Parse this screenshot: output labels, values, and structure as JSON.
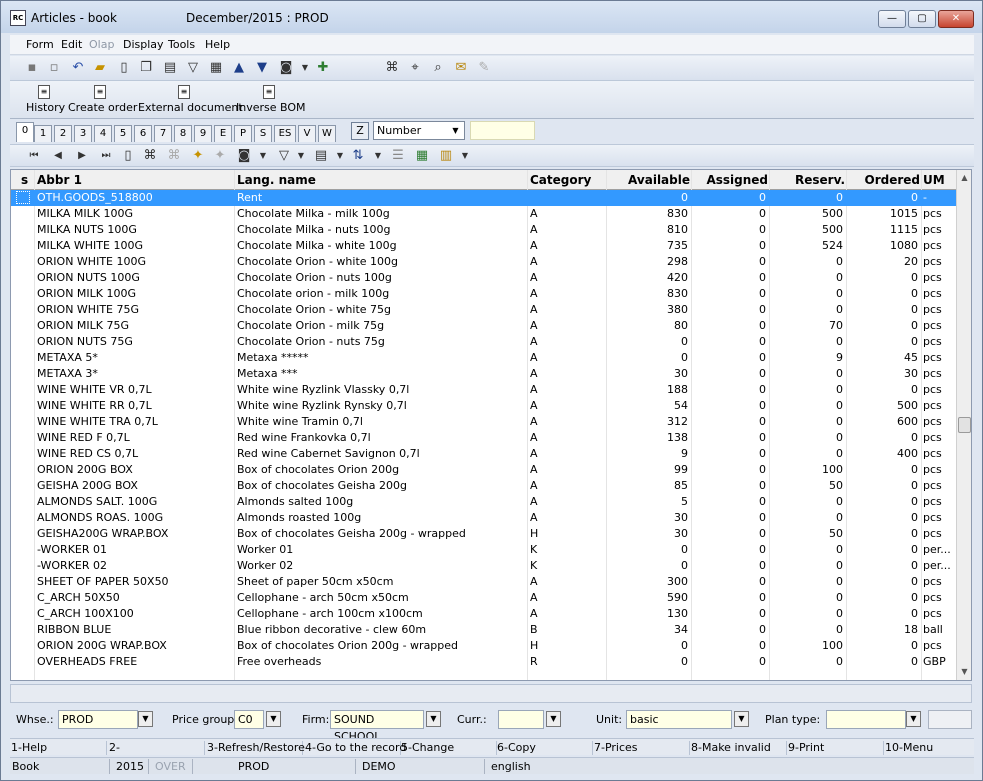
{
  "window": {
    "app_icon_text": "RC",
    "title": "Articles - book",
    "period": "December/2015 : PROD",
    "min_label": "—",
    "max_label": "▢",
    "close_label": "✕"
  },
  "menu": {
    "items": [
      "Form",
      "Edit",
      "Olap",
      "Display",
      "Tools",
      "Help"
    ],
    "disabled": [
      "Olap"
    ]
  },
  "toolbar": {
    "icons": [
      "save-icon",
      "save-as-icon",
      "undo-icon",
      "open-folder-icon",
      "new-document-icon",
      "copy-document-icon",
      "book-icon",
      "filter-icon",
      "filter-document-icon",
      "arrow-up-icon",
      "arrow-down-icon",
      "camera-icon",
      "dropdown-icon",
      "export-icon",
      "binoculars-icon",
      "find-next-icon",
      "find-prev-icon",
      "mail-icon",
      "edit-disabled-icon"
    ]
  },
  "ribbon": {
    "items": [
      {
        "label": "History"
      },
      {
        "label": "Create order"
      },
      {
        "label": "External document"
      },
      {
        "label": "Inverse BOM"
      }
    ]
  },
  "tabs": {
    "items": [
      "0",
      "1",
      "2",
      "3",
      "4",
      "5",
      "6",
      "7",
      "8",
      "9",
      "E",
      "P",
      "S",
      "ES",
      "V",
      "W"
    ],
    "active": "0"
  },
  "sort": {
    "z_label": "Z",
    "value": "Number",
    "dd": "▼"
  },
  "grid": {
    "columns": [
      "s",
      "Abbr 1",
      "Lang. name",
      "Category",
      "Available",
      "Assigned",
      "Reserv.",
      "Ordered",
      "UM"
    ],
    "rows": [
      [
        "",
        "OTH.GOODS_518800",
        "Rent",
        "",
        "0",
        "0",
        "0",
        "0",
        "-"
      ],
      [
        "",
        "MILKA MILK 100G",
        "Chocolate Milka - milk 100g",
        "A",
        "830",
        "0",
        "500",
        "1015",
        "pcs"
      ],
      [
        "",
        "MILKA NUTS 100G",
        "Chocolate Milka - nuts 100g",
        "A",
        "810",
        "0",
        "500",
        "1115",
        "pcs"
      ],
      [
        "",
        "MILKA WHITE 100G",
        "Chocolate Milka - white 100g",
        "A",
        "735",
        "0",
        "524",
        "1080",
        "pcs"
      ],
      [
        "",
        "ORION WHITE 100G",
        "Chocolate Orion - white 100g",
        "A",
        "298",
        "0",
        "0",
        "20",
        "pcs"
      ],
      [
        "",
        "ORION NUTS 100G",
        "Chocolate Orion - nuts 100g",
        "A",
        "420",
        "0",
        "0",
        "0",
        "pcs"
      ],
      [
        "",
        "ORION MILK 100G",
        "Chocolate orion - milk 100g",
        "A",
        "830",
        "0",
        "0",
        "0",
        "pcs"
      ],
      [
        "",
        "ORION WHITE 75G",
        "Chocolate Orion - white 75g",
        "A",
        "380",
        "0",
        "0",
        "0",
        "pcs"
      ],
      [
        "",
        "ORION MILK 75G",
        "Chocolate Orion - milk 75g",
        "A",
        "80",
        "0",
        "70",
        "0",
        "pcs"
      ],
      [
        "",
        "ORION NUTS 75G",
        "Chocolate Orion - nuts 75g",
        "A",
        "0",
        "0",
        "0",
        "0",
        "pcs"
      ],
      [
        "",
        "METAXA 5*",
        "Metaxa *****",
        "A",
        "0",
        "0",
        "9",
        "45",
        "pcs"
      ],
      [
        "",
        "METAXA 3*",
        "Metaxa ***",
        "A",
        "30",
        "0",
        "0",
        "30",
        "pcs"
      ],
      [
        "",
        "WINE WHITE VR 0,7L",
        "White wine Ryzlink Vlassky 0,7l",
        "A",
        "188",
        "0",
        "0",
        "0",
        "pcs"
      ],
      [
        "",
        "WINE WHITE RR 0,7L",
        "White wine Ryzlink Rynsky 0,7l",
        "A",
        "54",
        "0",
        "0",
        "500",
        "pcs"
      ],
      [
        "",
        "WINE WHITE TRA 0,7L",
        "White wine Tramin 0,7l",
        "A",
        "312",
        "0",
        "0",
        "600",
        "pcs"
      ],
      [
        "",
        "WINE RED F 0,7L",
        "Red wine Frankovka 0,7l",
        "A",
        "138",
        "0",
        "0",
        "0",
        "pcs"
      ],
      [
        "",
        "WINE RED CS 0,7L",
        "Red wine Cabernet Savignon 0,7l",
        "A",
        "9",
        "0",
        "0",
        "400",
        "pcs"
      ],
      [
        "",
        "ORION 200G BOX",
        "Box of chocolates Orion 200g",
        "A",
        "99",
        "0",
        "100",
        "0",
        "pcs"
      ],
      [
        "",
        "GEISHA 200G BOX",
        "Box of chocolates Geisha 200g",
        "A",
        "85",
        "0",
        "50",
        "0",
        "pcs"
      ],
      [
        "",
        "ALMONDS SALT.  100G",
        "Almonds salted 100g",
        "A",
        "5",
        "0",
        "0",
        "0",
        "pcs"
      ],
      [
        "",
        "ALMONDS ROAS.  100G",
        "Almonds roasted 100g",
        "A",
        "30",
        "0",
        "0",
        "0",
        "pcs"
      ],
      [
        "",
        "GEISHA200G WRAP.BOX",
        "Box of chocolates Geisha 200g - wrapped",
        "H",
        "30",
        "0",
        "50",
        "0",
        "pcs"
      ],
      [
        "",
        "-WORKER 01",
        "Worker 01",
        "K",
        "0",
        "0",
        "0",
        "0",
        "per..."
      ],
      [
        "",
        "-WORKER 02",
        "Worker 02",
        "K",
        "0",
        "0",
        "0",
        "0",
        "per..."
      ],
      [
        "",
        "SHEET OF PAPER 50X50",
        "Sheet of paper  50cm x50cm",
        "A",
        "300",
        "0",
        "0",
        "0",
        "pcs"
      ],
      [
        "",
        "C_ARCH 50X50",
        "Cellophane - arch 50cm x50cm",
        "A",
        "590",
        "0",
        "0",
        "0",
        "pcs"
      ],
      [
        "",
        "C_ARCH 100X100",
        "Cellophane - arch 100cm x100cm",
        "A",
        "130",
        "0",
        "0",
        "0",
        "pcs"
      ],
      [
        "",
        "RIBBON BLUE",
        "Blue ribbon decorative   - clew 60m",
        "B",
        "34",
        "0",
        "0",
        "18",
        "ball"
      ],
      [
        "",
        "ORION 200G WRAP.BOX",
        "Box of chocolates Orion 200g - wrapped",
        "H",
        "0",
        "0",
        "100",
        "0",
        "pcs"
      ],
      [
        "",
        "OVERHEADS FREE",
        "Free overheads",
        "R",
        "0",
        "0",
        "0",
        "0",
        "GBP"
      ]
    ],
    "selected_row": 0,
    "scroll_up": "▲",
    "scroll_down": "▼",
    "scroll_position": 0.5
  },
  "filters": {
    "whse_label": "Whse.:",
    "whse_value": "PROD",
    "price_group_label": "Price group:",
    "price_group_value": "C0",
    "firm_label": "Firm:",
    "firm_value": "SOUND SCHOOL",
    "curr_label": "Curr.:",
    "curr_value": "",
    "unit_label": "Unit:",
    "unit_value": "basic",
    "plan_type_label": "Plan type:",
    "plan_type_value": "",
    "dd": "▼"
  },
  "fkeys": [
    "1-Help",
    "2-",
    "3-Refresh/Restore",
    "4-Go to the record",
    "5-Change",
    "6-Copy",
    "7-Prices",
    "8-Make invalid",
    "9-Print",
    "10-Menu"
  ],
  "status": {
    "book": "Book",
    "year": "2015",
    "mode": "OVER",
    "db": "PROD",
    "company": "DEMO",
    "language": "english"
  }
}
